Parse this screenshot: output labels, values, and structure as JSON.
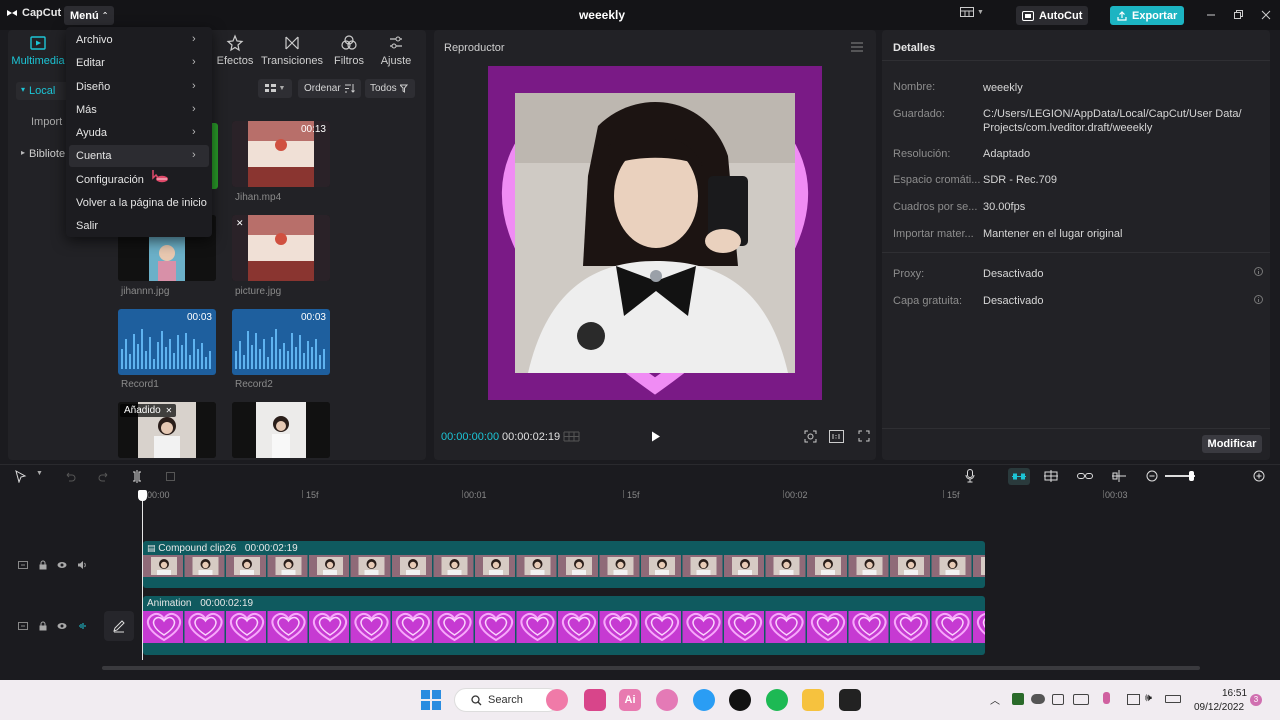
{
  "titlebar": {
    "app_name": "CapCut",
    "menu_label": "Menú",
    "document_title": "weeekly",
    "autocut_label": "AutoCut",
    "export_label": "Exportar"
  },
  "tool_tabs": [
    {
      "label": "Multimedia",
      "icon": "media-icon",
      "active": true
    },
    {
      "label": "Efectos",
      "icon": "effects-icon"
    },
    {
      "label": "Transiciones",
      "icon": "transitions-icon"
    },
    {
      "label": "Filtros",
      "icon": "filters-icon"
    },
    {
      "label": "Ajuste",
      "icon": "adjust-icon"
    }
  ],
  "sidebar": {
    "local": "Local",
    "import": "Import",
    "library": "Bibliote"
  },
  "media_toolbar": {
    "sort_label": "Ordenar",
    "filter_label": "Todos"
  },
  "media_items": [
    {
      "label": "Jihan.mp4",
      "duration": "00:13"
    },
    {
      "label": "jihannn.jpg"
    },
    {
      "label": "picture.jpg"
    },
    {
      "label": "Record1",
      "duration": "00:03"
    },
    {
      "label": "Record2",
      "duration": "00:03"
    },
    {
      "badge": "Añadido"
    }
  ],
  "menu_dropdown": {
    "items": [
      "Archivo",
      "Editar",
      "Diseño",
      "Más",
      "Ayuda",
      "Cuenta",
      "Configuración",
      "Volver a la página de inicio",
      "Salir"
    ]
  },
  "player": {
    "title": "Reproductor",
    "current_time": "00:00:00:00",
    "total_time": "00:00:02:19"
  },
  "details": {
    "title": "Detalles",
    "rows": [
      {
        "key": "Nombre:",
        "value": "weeekly"
      },
      {
        "key": "Guardado:",
        "value": "C:/Users/LEGION/AppData/Local/CapCut/User Data/ Projects/com.lveditor.draft/weeekly"
      },
      {
        "key": "Resolución:",
        "value": "Adaptado"
      },
      {
        "key": "Espacio cromáti...",
        "value": "SDR - Rec.709"
      },
      {
        "key": "Cuadros por se...",
        "value": "30.00fps"
      },
      {
        "key": "Importar mater...",
        "value": "Mantener en el lugar original"
      },
      {
        "key": "Proxy:",
        "value": "Desactivado"
      },
      {
        "key": "Capa gratuita:",
        "value": "Desactivado"
      }
    ],
    "modify_label": "Modificar"
  },
  "timeline": {
    "ruler": [
      "00:00",
      "15f",
      "00:01",
      "15f",
      "00:02",
      "15f",
      "00:03"
    ],
    "clip_main": {
      "name": "Compound clip26",
      "duration": "00:00:02:19"
    },
    "clip_anim": {
      "name": "Animation",
      "duration": "00:00:02:19"
    }
  },
  "taskbar": {
    "search_label": "Search",
    "time": "16:51",
    "date": "09/12/2022",
    "notification_count": "3"
  },
  "colors": {
    "accent": "#1cc5d6",
    "export": "#1cb4c2",
    "clip": "#0f5a5f",
    "heart": "#d84de0"
  }
}
